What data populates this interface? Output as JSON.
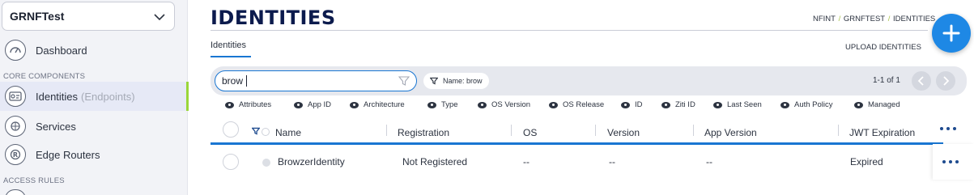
{
  "sidebar": {
    "network": "GRNFTest",
    "dashboard_label": "Dashboard",
    "section_core": "CORE COMPONENTS",
    "identities_label": "Identities",
    "identities_sub": "(Endpoints)",
    "services_label": "Services",
    "edge_routers_label": "Edge Routers",
    "section_access": "ACCESS RULES"
  },
  "header": {
    "title": "IDENTITIES",
    "breadcrumb": [
      "NFINT",
      "GRNFTEST",
      "IDENTITIES"
    ],
    "tab": "Identities",
    "upload": "UPLOAD IDENTITIES"
  },
  "search": {
    "value": "brow",
    "chip": "Name: brow",
    "paging": "1-1 of 1"
  },
  "column_toggles": [
    "Attributes",
    "App ID",
    "Architecture",
    "Type",
    "OS Version",
    "OS Release",
    "ID",
    "Ziti ID",
    "Last Seen",
    "Auth Policy",
    "Managed"
  ],
  "table": {
    "columns": [
      "Name",
      "Registration",
      "OS",
      "Version",
      "App Version",
      "JWT Expiration"
    ],
    "rows": [
      {
        "name": "BrowzerIdentity",
        "registration": "Not Registered",
        "os": "--",
        "version": "--",
        "app_version": "--",
        "jwt": "Expired"
      }
    ]
  },
  "colors": {
    "accent": "#1976d2",
    "title": "#0c1b4d",
    "active_bar": "#9ad63a"
  }
}
